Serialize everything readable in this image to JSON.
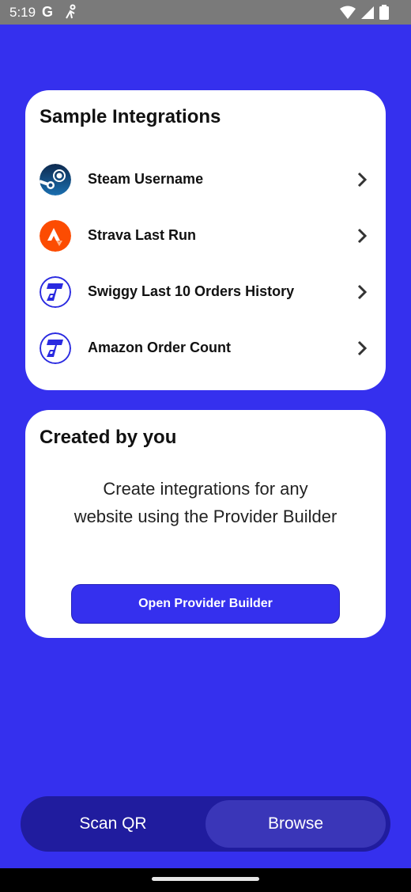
{
  "status_bar": {
    "time": "5:19",
    "google_glyph": "G",
    "icons": [
      "google-icon",
      "accessibility-icon",
      "wifi-icon",
      "signal-icon",
      "battery-icon"
    ]
  },
  "samples": {
    "title": "Sample Integrations",
    "items": [
      {
        "label": "Steam Username",
        "icon": "steam-logo-icon"
      },
      {
        "label": "Strava Last Run",
        "icon": "strava-logo-icon"
      },
      {
        "label": "Swiggy Last 10 Orders History",
        "icon": "provider-logo-icon"
      },
      {
        "label": "Amazon Order Count",
        "icon": "provider-logo-icon"
      }
    ]
  },
  "created": {
    "title": "Created by you",
    "description": "Create integrations for any website using the Provider Builder",
    "button_label": "Open Provider Builder"
  },
  "bottom_nav": {
    "scan_label": "Scan QR",
    "browse_label": "Browse",
    "selected": "Browse"
  },
  "colors": {
    "background": "#3530EE",
    "card": "#FFFFFF",
    "bottom_bar": "#201C9E",
    "selected_tab": "#3A36B8",
    "strava": "#FC4C02"
  }
}
